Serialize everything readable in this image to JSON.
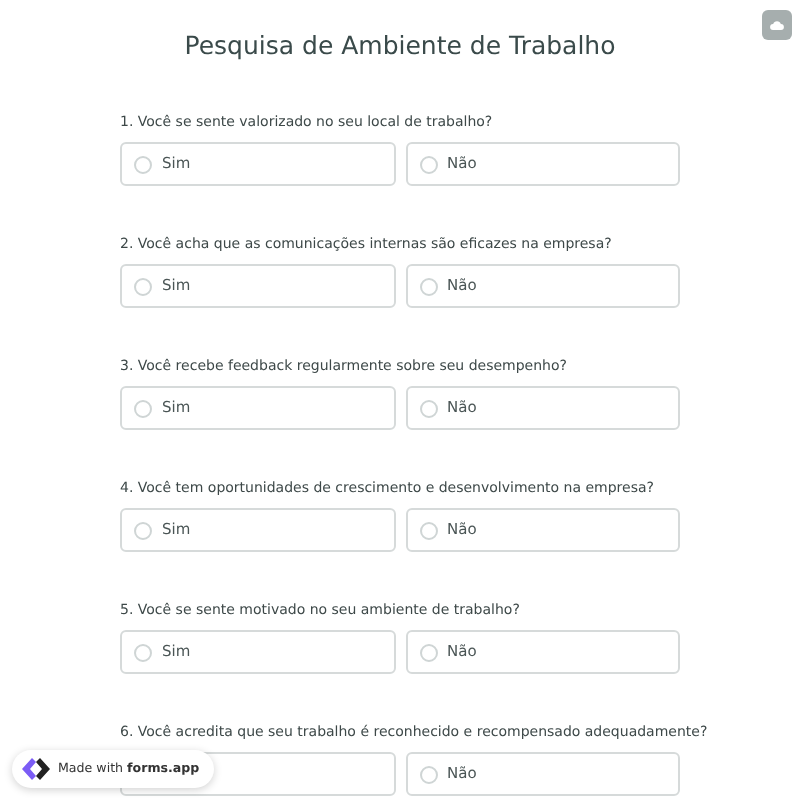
{
  "title": "Pesquisa de Ambiente de Trabalho",
  "questions": [
    {
      "text": "1. Você se sente valorizado no seu local de trabalho?",
      "options": [
        {
          "label": "Sim",
          "selected": false
        },
        {
          "label": "Não",
          "selected": false
        }
      ]
    },
    {
      "text": "2. Você acha que as comunicações internas são eficazes na empresa?",
      "options": [
        {
          "label": "Sim",
          "selected": false
        },
        {
          "label": "Não",
          "selected": false
        }
      ]
    },
    {
      "text": "3. Você recebe feedback regularmente sobre seu desempenho?",
      "options": [
        {
          "label": "Sim",
          "selected": false
        },
        {
          "label": "Não",
          "selected": false
        }
      ]
    },
    {
      "text": "4. Você tem oportunidades de crescimento e desenvolvimento na empresa?",
      "options": [
        {
          "label": "Sim",
          "selected": false
        },
        {
          "label": "Não",
          "selected": false
        }
      ]
    },
    {
      "text": "5. Você se sente motivado no seu ambiente de trabalho?",
      "options": [
        {
          "label": "Sim",
          "selected": false
        },
        {
          "label": "Não",
          "selected": false
        }
      ]
    },
    {
      "text": "6. Você acredita que seu trabalho é reconhecido e recompensado adequadamente?",
      "options": [
        {
          "selected": false
        },
        {
          "label": "Não",
          "selected": false
        }
      ]
    }
  ],
  "badge": "Made with **forms.app**"
}
